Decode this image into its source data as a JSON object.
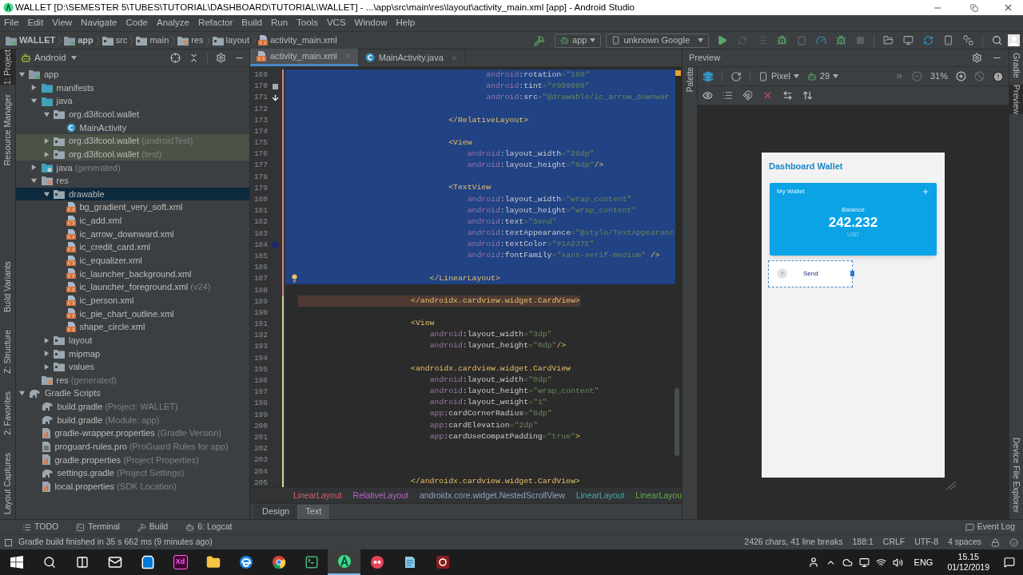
{
  "window": {
    "title": "WALLET [D:\\SEMESTER 5\\TUBES\\TUTORIAL\\DASHBOARD\\TUTORIAL\\WALLET] - ...\\app\\src\\main\\res\\layout\\activity_main.xml [app] - Android Studio"
  },
  "menu": [
    "File",
    "Edit",
    "View",
    "Navigate",
    "Code",
    "Analyze",
    "Refactor",
    "Build",
    "Run",
    "Tools",
    "VCS",
    "Window",
    "Help"
  ],
  "nav_path": [
    {
      "label": "WALLET",
      "kind": "project"
    },
    {
      "label": "app",
      "kind": "module"
    },
    {
      "label": "src",
      "kind": "folder"
    },
    {
      "label": "main",
      "kind": "folder"
    },
    {
      "label": "res",
      "kind": "res"
    },
    {
      "label": "layout",
      "kind": "folder"
    },
    {
      "label": "activity_main.xml",
      "kind": "xml"
    }
  ],
  "run_toolbar": {
    "config": "app",
    "device": "unknown Google"
  },
  "left_stripe": {
    "top": [
      {
        "label": "1: Project",
        "selected": true
      },
      {
        "label": "Resource Manager",
        "selected": false
      }
    ],
    "bottom": [
      {
        "label": "Build Variants",
        "selected": false
      },
      {
        "label": "Z: Structure",
        "selected": false
      },
      {
        "label": "2: Favorites",
        "selected": false
      },
      {
        "label": "Layout Captures",
        "selected": false
      }
    ]
  },
  "project": {
    "view": "Android",
    "tree": [
      {
        "label": "app",
        "kind": "module",
        "expanded": true,
        "selected": false,
        "tinted": false,
        "children": [
          {
            "label": "manifests",
            "kind": "srcfolder",
            "expanded": false,
            "selected": false,
            "tinted": false
          },
          {
            "label": "java",
            "kind": "srcfolder",
            "expanded": true,
            "selected": false,
            "tinted": false,
            "children": [
              {
                "label": "org.d3ifcool.wallet",
                "kind": "package",
                "expanded": true,
                "selected": false,
                "tinted": false,
                "children": [
                  {
                    "label": "MainActivity",
                    "kind": "class",
                    "selected": false,
                    "tinted": false
                  }
                ]
              },
              {
                "label": "org.d3ifcool.wallet",
                "note": "(androidTest)",
                "kind": "package",
                "expanded": false,
                "selected": false,
                "tinted": true
              },
              {
                "label": "org.d3ifcool.wallet",
                "note": "(test)",
                "kind": "package",
                "expanded": false,
                "selected": false,
                "tinted": true
              }
            ]
          },
          {
            "label": "java",
            "note": "(generated)",
            "kind": "genfolder",
            "expanded": false,
            "selected": false,
            "tinted": false
          },
          {
            "label": "res",
            "kind": "res",
            "expanded": true,
            "selected": false,
            "tinted": false,
            "children": [
              {
                "label": "drawable",
                "kind": "package",
                "expanded": true,
                "selected": true,
                "tinted": false,
                "children": [
                  {
                    "label": "bg_gradient_very_soft.xml",
                    "kind": "xml",
                    "selected": false,
                    "tinted": false
                  },
                  {
                    "label": "ic_add.xml",
                    "kind": "xml",
                    "selected": false,
                    "tinted": false
                  },
                  {
                    "label": "ic_arrow_downward.xml",
                    "kind": "xml",
                    "selected": false,
                    "tinted": false
                  },
                  {
                    "label": "ic_credit_card.xml",
                    "kind": "xml",
                    "selected": false,
                    "tinted": false
                  },
                  {
                    "label": "ic_equalizer.xml",
                    "kind": "xml",
                    "selected": false,
                    "tinted": false
                  },
                  {
                    "label": "ic_launcher_background.xml",
                    "kind": "xml",
                    "selected": false,
                    "tinted": false
                  },
                  {
                    "label": "ic_launcher_foreground.xml",
                    "note": "(v24)",
                    "kind": "xml",
                    "selected": false,
                    "tinted": false
                  },
                  {
                    "label": "ic_person.xml",
                    "kind": "xml",
                    "selected": false,
                    "tinted": false
                  },
                  {
                    "label": "ic_pie_chart_outline.xml",
                    "kind": "xml",
                    "selected": false,
                    "tinted": false
                  },
                  {
                    "label": "shape_circle.xml",
                    "kind": "xml",
                    "selected": false,
                    "tinted": false
                  }
                ]
              },
              {
                "label": "layout",
                "kind": "package",
                "expanded": false,
                "selected": false,
                "tinted": false
              },
              {
                "label": "mipmap",
                "kind": "package",
                "expanded": false,
                "selected": false,
                "tinted": false
              },
              {
                "label": "values",
                "kind": "package",
                "expanded": false,
                "selected": false,
                "tinted": false
              }
            ]
          },
          {
            "label": "res",
            "note": "(generated)",
            "kind": "res",
            "selected": false,
            "tinted": false
          }
        ]
      },
      {
        "label": "Gradle Scripts",
        "kind": "gradle",
        "expanded": true,
        "selected": false,
        "tinted": false,
        "children": [
          {
            "label": "build.gradle",
            "note": "(Project: WALLET)",
            "kind": "gradle",
            "selected": false,
            "tinted": false
          },
          {
            "label": "build.gradle",
            "note": "(Module: app)",
            "kind": "gradle",
            "selected": false,
            "tinted": false
          },
          {
            "label": "gradle-wrapper.properties",
            "note": "(Gradle Version)",
            "kind": "properties",
            "selected": false,
            "tinted": false
          },
          {
            "label": "proguard-rules.pro",
            "note": "(ProGuard Rules for app)",
            "kind": "file",
            "selected": false,
            "tinted": false
          },
          {
            "label": "gradle.properties",
            "note": "(Project Properties)",
            "kind": "properties",
            "selected": false,
            "tinted": false
          },
          {
            "label": "settings.gradle",
            "note": "(Project Settings)",
            "kind": "gradle",
            "selected": false,
            "tinted": false
          },
          {
            "label": "local.properties",
            "note": "(SDK Location)",
            "kind": "properties",
            "selected": false,
            "tinted": false
          }
        ]
      }
    ]
  },
  "editor": {
    "tabs": [
      {
        "label": "activity_main.xml",
        "kind": "xml",
        "selected": true
      },
      {
        "label": "MainActivity.java",
        "kind": "class",
        "selected": false
      }
    ],
    "lines": [
      {
        "num": "169",
        "text": "                                        android:rotation=\"180\"",
        "selected": true,
        "matched": false,
        "color": "#c98a86"
      },
      {
        "num": "170",
        "text": "                                        android:tint=\"#999999\"",
        "selected": true,
        "matched": false,
        "color": "#c98a86",
        "kind": "square"
      },
      {
        "num": "171",
        "text": "                                        android:src=\"@drawable/ic_arrow_downwar",
        "selected": true,
        "matched": false,
        "color": "#c98a86",
        "kind": "arrow"
      },
      {
        "num": "172",
        "selected": true,
        "matched": false,
        "color": "#c98a86"
      },
      {
        "num": "173",
        "text": "                                </RelativeLayout>",
        "selected": true,
        "matched": false,
        "color": "#c98a86"
      },
      {
        "num": "174",
        "selected": true,
        "matched": false,
        "color": "#c98a86"
      },
      {
        "num": "175",
        "text": "                                <View",
        "selected": true,
        "matched": false,
        "color": "#c98a86"
      },
      {
        "num": "176",
        "text": "                                    android:layout_width=\"20dp\"",
        "selected": true,
        "matched": false,
        "color": "#c98a86"
      },
      {
        "num": "177",
        "text": "                                    android:layout_height=\"0dp\"/>",
        "selected": true,
        "matched": false,
        "color": "#c98a86"
      },
      {
        "num": "178",
        "selected": true,
        "matched": false,
        "color": "#c98a86"
      },
      {
        "num": "179",
        "text": "                                <TextView",
        "selected": true,
        "matched": false,
        "color": "#c98a86"
      },
      {
        "num": "180",
        "text": "                                    android:layout_width=\"wrap_content\"",
        "selected": true,
        "matched": false,
        "color": "#c98a86"
      },
      {
        "num": "181",
        "text": "                                    android:layout_height=\"wrap_content\"",
        "selected": true,
        "matched": false,
        "color": "#c98a86"
      },
      {
        "num": "182",
        "text": "                                    android:text=\"Send\"",
        "selected": true,
        "matched": false,
        "color": "#c98a86"
      },
      {
        "num": "183",
        "text": "                                    android:textAppearance=\"@style/TextAppearanc",
        "selected": true,
        "matched": false,
        "color": "#c98a86"
      },
      {
        "num": "184",
        "text": "                                    android:textColor=\"#1A237E\"",
        "selected": true,
        "matched": false,
        "color": "#c98a86",
        "kind": "swatch"
      },
      {
        "num": "185",
        "text": "                                    android:fontFamily=\"sans-serif-medium\" />",
        "selected": true,
        "matched": false,
        "color": "#c98a86"
      },
      {
        "num": "186",
        "selected": true,
        "matched": false,
        "color": "#c98a86"
      },
      {
        "num": "187",
        "text": "                            </LinearLayout>",
        "selected": true,
        "matched": false,
        "color": "#c98a86",
        "kind": "bulb"
      },
      {
        "num": "188",
        "selected": false,
        "matched": false,
        "color": "#c98a86"
      },
      {
        "num": "189",
        "text": "                        </androidx.cardview.widget.CardView>",
        "selected": false,
        "matched": true,
        "color": "#d9d28c"
      },
      {
        "num": "190",
        "selected": false,
        "matched": false,
        "color": "#d9d28c"
      },
      {
        "num": "191",
        "text": "                        <View",
        "selected": false,
        "matched": false,
        "color": "#d9d28c"
      },
      {
        "num": "192",
        "text": "                            android:layout_width=\"3dp\"",
        "selected": false,
        "matched": false,
        "color": "#d9d28c"
      },
      {
        "num": "193",
        "text": "                            android:layout_height=\"0dp\"/>",
        "selected": false,
        "matched": false,
        "color": "#d9d28c"
      },
      {
        "num": "194",
        "selected": false,
        "matched": false,
        "color": "#d9d28c"
      },
      {
        "num": "195",
        "text": "                        <androidx.cardview.widget.CardView",
        "selected": false,
        "matched": false,
        "color": "#d9d28c"
      },
      {
        "num": "196",
        "text": "                            android:layout_width=\"0dp\"",
        "selected": false,
        "matched": false,
        "color": "#d9d28c"
      },
      {
        "num": "197",
        "text": "                            android:layout_height=\"wrap_content\"",
        "selected": false,
        "matched": false,
        "color": "#d9d28c"
      },
      {
        "num": "198",
        "text": "                            android:layout_weight=\"1\"",
        "selected": false,
        "matched": false,
        "color": "#d9d28c"
      },
      {
        "num": "199",
        "text": "                            app:cardCornerRadius=\"6dp\"",
        "selected": false,
        "matched": false,
        "color": "#d9d28c"
      },
      {
        "num": "200",
        "text": "                            app:cardElevation=\"2dp\"",
        "selected": false,
        "matched": false,
        "color": "#d9d28c"
      },
      {
        "num": "201",
        "text": "                            app:cardUseCompatPadding=\"true\">",
        "selected": false,
        "matched": false,
        "color": "#d9d28c"
      },
      {
        "num": "202",
        "selected": false,
        "matched": false,
        "color": "#d9d28c"
      },
      {
        "num": "203",
        "selected": false,
        "matched": false,
        "color": "#d9d28c"
      },
      {
        "num": "204",
        "selected": false,
        "matched": false,
        "color": "#d9d28c"
      },
      {
        "num": "205",
        "text": "                        </androidx.cardview.widget.CardView>",
        "selected": false,
        "matched": false,
        "color": "#d9d28c"
      }
    ],
    "breadcrumb": [
      {
        "label": "LinearLayout",
        "color": "#cf6467"
      },
      {
        "label": "RelativeLayout",
        "color": "#b868c4"
      },
      {
        "label": "androidx.core.widget.NestedScrollView",
        "color": "#8fa3c4"
      },
      {
        "label": "LinearLayout",
        "color": "#4aa8b0"
      },
      {
        "label": "LinearLayou",
        "color": "#62ad4c"
      }
    ],
    "modes": [
      {
        "label": "Design",
        "selected": false
      },
      {
        "label": "Text",
        "selected": true
      }
    ]
  },
  "preview": {
    "title": "Preview",
    "palette": "Palette",
    "device": "Pixel",
    "api": "29",
    "zoom": "31%",
    "screen": {
      "title": "Dashboard Wallet",
      "card": {
        "title": "My Wallet",
        "label": "Balance",
        "amount": "242.232",
        "currency": "USD"
      },
      "action": "Send"
    }
  },
  "right_stripe": {
    "top": [
      {
        "label": "Gradle",
        "selected": false
      },
      {
        "label": "Preview",
        "selected": true
      }
    ],
    "bottom": [
      {
        "label": "Device File Explorer",
        "selected": false
      }
    ]
  },
  "tool_windows": {
    "left": [
      {
        "label": "TODO",
        "kind": "list"
      },
      {
        "label": "Terminal",
        "kind": "terminal"
      },
      {
        "label": "Build",
        "kind": "build"
      },
      {
        "label": "6: Logcat",
        "kind": "android"
      }
    ],
    "right": {
      "label": "Event Log"
    }
  },
  "status": {
    "message": "Gradle build finished in 35 s 662 ms (9 minutes ago)",
    "fields": [
      "2426 chars, 41 line breaks",
      "188:1",
      "CRLF",
      "UTF-8",
      "4 spaces"
    ]
  },
  "taskbar": {
    "items": [
      {
        "kind": "start",
        "active": false
      },
      {
        "kind": "search",
        "active": false
      },
      {
        "kind": "taskview",
        "active": false
      },
      {
        "kind": "mail",
        "active": false
      },
      {
        "kind": "store",
        "active": false
      },
      {
        "kind": "xd",
        "label": "Xd",
        "active": false
      },
      {
        "kind": "explorer",
        "active": false
      },
      {
        "kind": "edge",
        "active": false
      },
      {
        "kind": "chrome",
        "active": false
      },
      {
        "kind": "terminal",
        "active": false
      },
      {
        "kind": "studio",
        "active": true
      },
      {
        "kind": "media",
        "active": false
      },
      {
        "kind": "notes",
        "active": false
      },
      {
        "kind": "app",
        "active": false
      }
    ],
    "language": "ENG",
    "time": "15.15",
    "date": "01/12/2019"
  }
}
